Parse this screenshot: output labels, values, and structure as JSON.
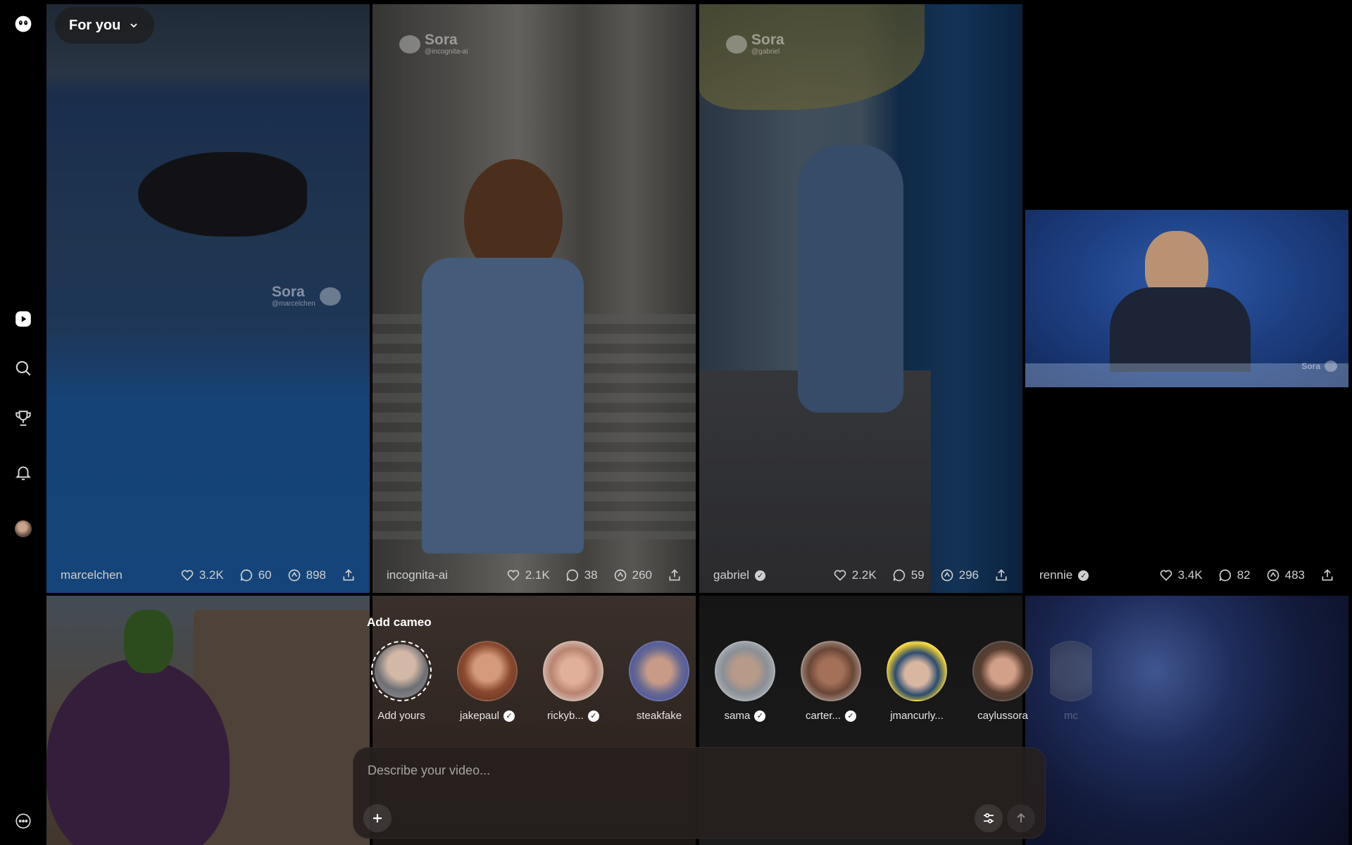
{
  "feed": {
    "selector_label": "For you"
  },
  "sidebar": {
    "items": [
      {
        "name": "home"
      },
      {
        "name": "explore"
      },
      {
        "name": "leaderboard"
      },
      {
        "name": "notifications"
      },
      {
        "name": "profile"
      },
      {
        "name": "more"
      }
    ]
  },
  "posts": [
    {
      "author": "marcelchen",
      "verified": false,
      "likes": "3.2K",
      "comments": "60",
      "remixes": "898",
      "watermark_name": "Sora",
      "watermark_handle": "@marcelchen"
    },
    {
      "author": "incognita-ai",
      "verified": false,
      "likes": "2.1K",
      "comments": "38",
      "remixes": "260",
      "watermark_name": "Sora",
      "watermark_handle": "@incognita-ai"
    },
    {
      "author": "gabriel",
      "verified": true,
      "likes": "2.2K",
      "comments": "59",
      "remixes": "296",
      "watermark_name": "Sora",
      "watermark_handle": "@gabriel"
    },
    {
      "author": "rennie",
      "verified": true,
      "likes": "3.4K",
      "comments": "82",
      "remixes": "483",
      "watermark_name": "Sora",
      "watermark_handle": ""
    }
  ],
  "cameo": {
    "title": "Add cameo",
    "items": [
      {
        "name": "Add yours",
        "verified": false
      },
      {
        "name": "jakepaul",
        "verified": true
      },
      {
        "name": "rickyb...",
        "verified": true
      },
      {
        "name": "steakfake",
        "verified": false
      },
      {
        "name": "sama",
        "verified": true
      },
      {
        "name": "carter...",
        "verified": true
      },
      {
        "name": "jmancurly...",
        "verified": false
      },
      {
        "name": "caylussora",
        "verified": false
      },
      {
        "name": "mc",
        "verified": false
      }
    ]
  },
  "prompt": {
    "placeholder": "Describe your video..."
  },
  "colors": {
    "background": "#000000",
    "panel": "#26201e",
    "text": "#ffffff",
    "muted": "#cfcfcf"
  }
}
